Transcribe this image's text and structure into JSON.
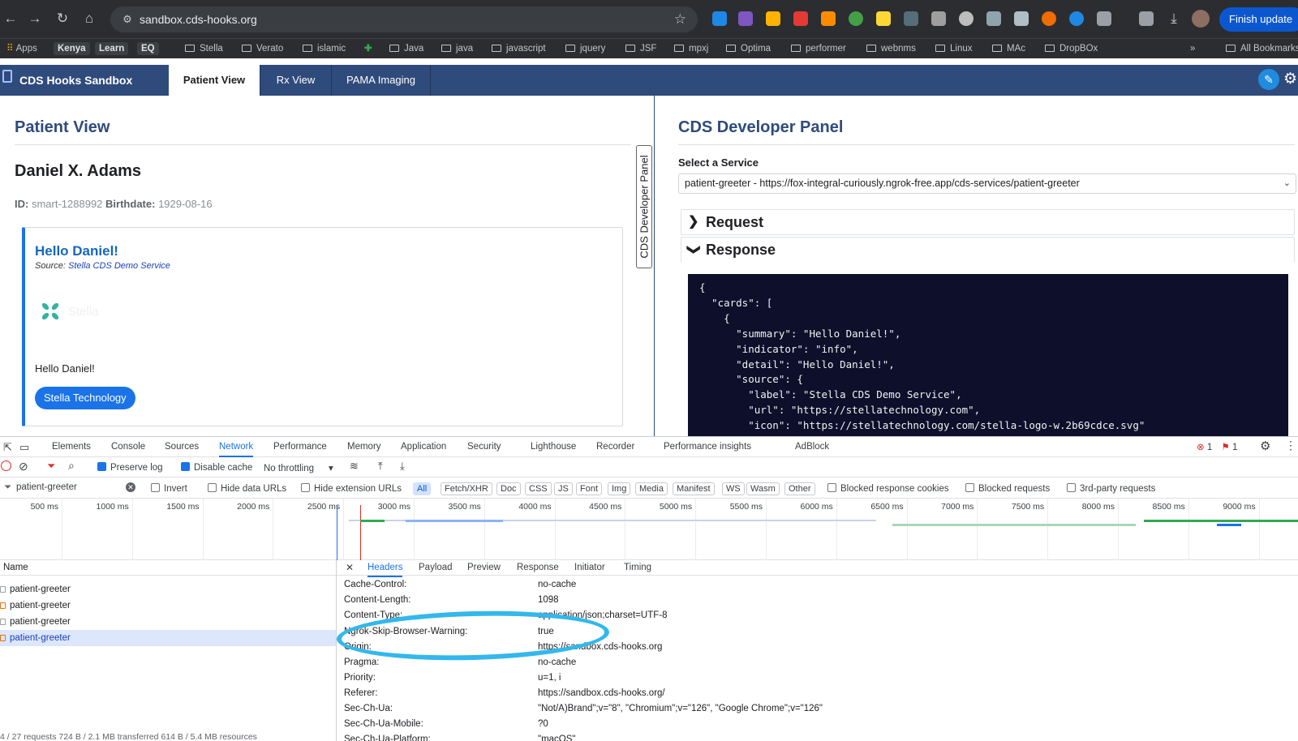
{
  "browser": {
    "url": "sandbox.cds-hooks.org",
    "finish_update": "Finish update",
    "bookmarks": [
      "Apps",
      "Kenya",
      "Learn",
      "EQ",
      "Stella",
      "Verato",
      "islamic",
      "Java",
      "java",
      "javascript",
      "jquery",
      "JSF",
      "mpxj",
      "Optima",
      "performer",
      "webnms",
      "Linux",
      "MAc",
      "DropBOx",
      "All Bookmarks"
    ],
    "more": "»"
  },
  "app": {
    "title": "CDS Hooks Sandbox",
    "tabs": [
      "Patient View",
      "Rx View",
      "PAMA Imaging"
    ]
  },
  "patient_view": {
    "title": "Patient View",
    "name": "Daniel X. Adams",
    "id_label": "ID:",
    "id": "smart-1288992",
    "birthdate_label": "Birthdate:",
    "birthdate": "1929-08-16",
    "card": {
      "summary": "Hello Daniel!",
      "source_label": "Source:",
      "source": "Stella CDS Demo Service",
      "logo_text": "Stella",
      "detail": "Hello Daniel!",
      "link": "Stella Technology"
    },
    "side_tab": "CDS Developer Panel"
  },
  "dev_panel": {
    "title": "CDS Developer Panel",
    "select_label": "Select a Service",
    "service": "patient-greeter - https://fox-integral-curiously.ngrok-free.app/cds-services/patient-greeter",
    "request": "Request",
    "response": "Response",
    "code": "{\n  \"cards\": [\n    {\n      \"summary\": \"Hello Daniel!\",\n      \"indicator\": \"info\",\n      \"detail\": \"Hello Daniel!\",\n      \"source\": {\n        \"label\": \"Stella CDS Demo Service\",\n        \"url\": \"https://stellatechnology.com\",\n        \"icon\": \"https://stellatechnology.com/stella-logo-w.2b69cdce.svg\""
  },
  "devtools": {
    "tabs": [
      "Elements",
      "Console",
      "Sources",
      "Network",
      "Performance",
      "Memory",
      "Application",
      "Security",
      "Lighthouse",
      "Recorder",
      "Performance insights",
      "AdBlock"
    ],
    "errors": "1",
    "warnings": "1",
    "preserve_log": "Preserve log",
    "disable_cache": "Disable cache",
    "throttling": "No throttling",
    "filter_value": "patient-greeter",
    "invert": "Invert",
    "hide_data_urls": "Hide data URLs",
    "hide_ext_urls": "Hide extension URLs",
    "type_filters": [
      "All",
      "Fetch/XHR",
      "Doc",
      "CSS",
      "JS",
      "Font",
      "Img",
      "Media",
      "Manifest",
      "WS",
      "Wasm",
      "Other"
    ],
    "blocked_cookies": "Blocked response cookies",
    "blocked_requests": "Blocked requests",
    "third_party": "3rd-party requests",
    "timeline_ticks": [
      "500 ms",
      "1000 ms",
      "1500 ms",
      "2000 ms",
      "2500 ms",
      "3000 ms",
      "3500 ms",
      "4000 ms",
      "4500 ms",
      "5000 ms",
      "5500 ms",
      "6000 ms",
      "6500 ms",
      "7000 ms",
      "7500 ms",
      "8000 ms",
      "8500 ms",
      "9000 ms"
    ],
    "name_header": "Name",
    "requests": [
      "patient-greeter",
      "patient-greeter",
      "patient-greeter",
      "patient-greeter"
    ],
    "detail_tabs": [
      "Headers",
      "Payload",
      "Preview",
      "Response",
      "Initiator",
      "Timing"
    ],
    "headers": [
      {
        "k": "Cache-Control:",
        "v": "no-cache"
      },
      {
        "k": "Content-Length:",
        "v": "1098"
      },
      {
        "k": "Content-Type:",
        "v": "application/json;charset=UTF-8"
      },
      {
        "k": "Ngrok-Skip-Browser-Warning:",
        "v": "true"
      },
      {
        "k": "Origin:",
        "v": "https://sandbox.cds-hooks.org"
      },
      {
        "k": "Pragma:",
        "v": "no-cache"
      },
      {
        "k": "Priority:",
        "v": "u=1, i"
      },
      {
        "k": "Referer:",
        "v": "https://sandbox.cds-hooks.org/"
      },
      {
        "k": "Sec-Ch-Ua:",
        "v": "\"Not/A)Brand\";v=\"8\", \"Chromium\";v=\"126\", \"Google Chrome\";v=\"126\""
      },
      {
        "k": "Sec-Ch-Ua-Mobile:",
        "v": "?0"
      },
      {
        "k": "Sec-Ch-Ua-Platform:",
        "v": "\"macOS\""
      }
    ],
    "status": "4 / 27 requests   724 B / 2.1 MB transferred   614 B / 5.4 MB resources"
  },
  "colors": {
    "app_header": "#2f4b7c",
    "accent": "#1a73e8",
    "highlight_circle": "#32b8ec"
  }
}
